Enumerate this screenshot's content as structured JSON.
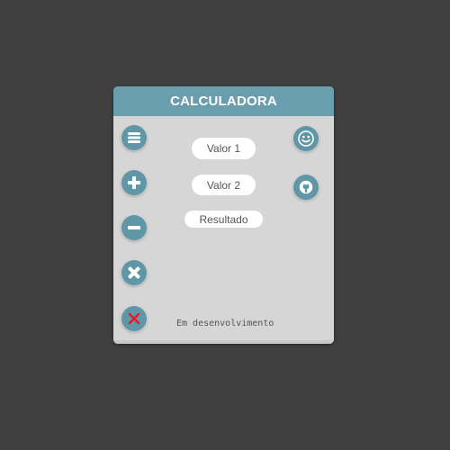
{
  "app": {
    "title": "CALCULADORA"
  },
  "inputs": {
    "valor1_placeholder": "Valor 1",
    "valor2_placeholder": "Valor 2",
    "resultado_placeholder": "Resultado"
  },
  "left_buttons": [
    {
      "icon": "menu-icon"
    },
    {
      "icon": "plus-icon"
    },
    {
      "icon": "minus-icon"
    },
    {
      "icon": "multiply-icon"
    },
    {
      "icon": "close-icon"
    }
  ],
  "right_buttons": [
    {
      "icon": "smiley-icon"
    },
    {
      "icon": "github-icon"
    }
  ],
  "footer": {
    "status": "Em desenvolvimento"
  },
  "colors": {
    "background": "#3f3f3f",
    "header": "#6a9eae",
    "card": "#d6d6d6",
    "button": "#5f97a6",
    "close_x": "#e8182a"
  }
}
